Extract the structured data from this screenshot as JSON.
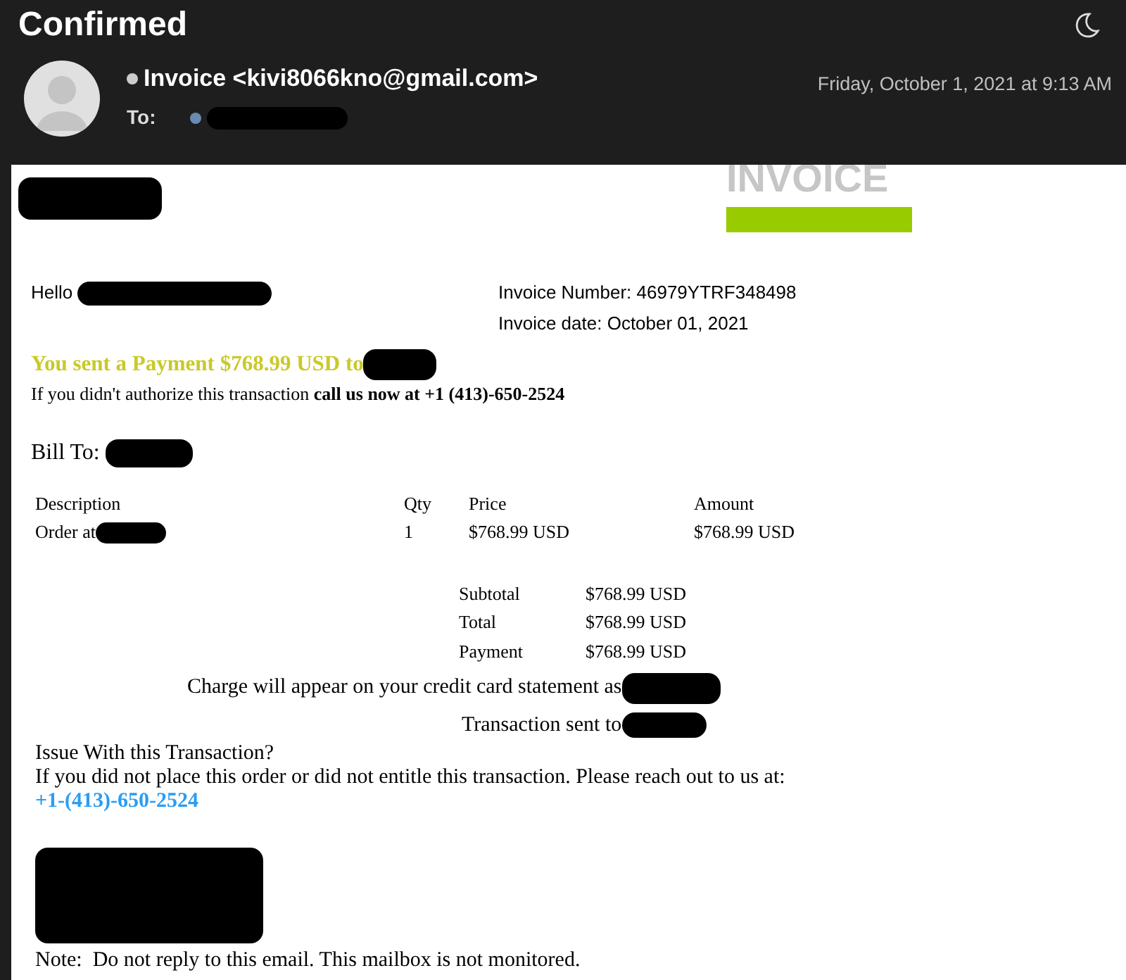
{
  "window": {
    "title": "Confirmed"
  },
  "header": {
    "sender": "Invoice <kivi8066kno@gmail.com>",
    "to_label": "To:",
    "date": "Friday, October 1, 2021 at 9:13 AM"
  },
  "email": {
    "invoice_title": "INVOICE",
    "greeting": "Hello",
    "invoice_number": "Invoice Number: 46979YTRF348498",
    "invoice_date": "Invoice date: October 01, 2021",
    "payment_headline": "You sent a Payment $768.99 USD to",
    "authorize_note": "If you didn't authorize this transaction **call us now at +1 (413)-650-2524**",
    "bill_to": "Bill To:",
    "items": {
      "columns": [
        "Description",
        "Qty",
        "Price",
        "Amount"
      ],
      "rows": [
        [
          "Order at",
          "1",
          "$768.99 USD",
          "$768.99 USD"
        ]
      ]
    },
    "totals": [
      {
        "label": "Subtotal",
        "value": "$768.99 USD"
      },
      {
        "label": "Total",
        "value": "$768.99 USD"
      },
      {
        "label": "Payment",
        "value": "$768.99 USD"
      }
    ],
    "charge_note": "Charge will appear on your credit card statement as",
    "sent_to": "Transaction sent to",
    "issue_title": "Issue With this Transaction?",
    "issue_text": "If you did not place this order or did not entitle this transaction. Please reach out to us at:",
    "issue_phone": "+1-(413)-650-2524",
    "footer_note": "Note:  Do not reply to this email. This mailbox is not monitored."
  }
}
